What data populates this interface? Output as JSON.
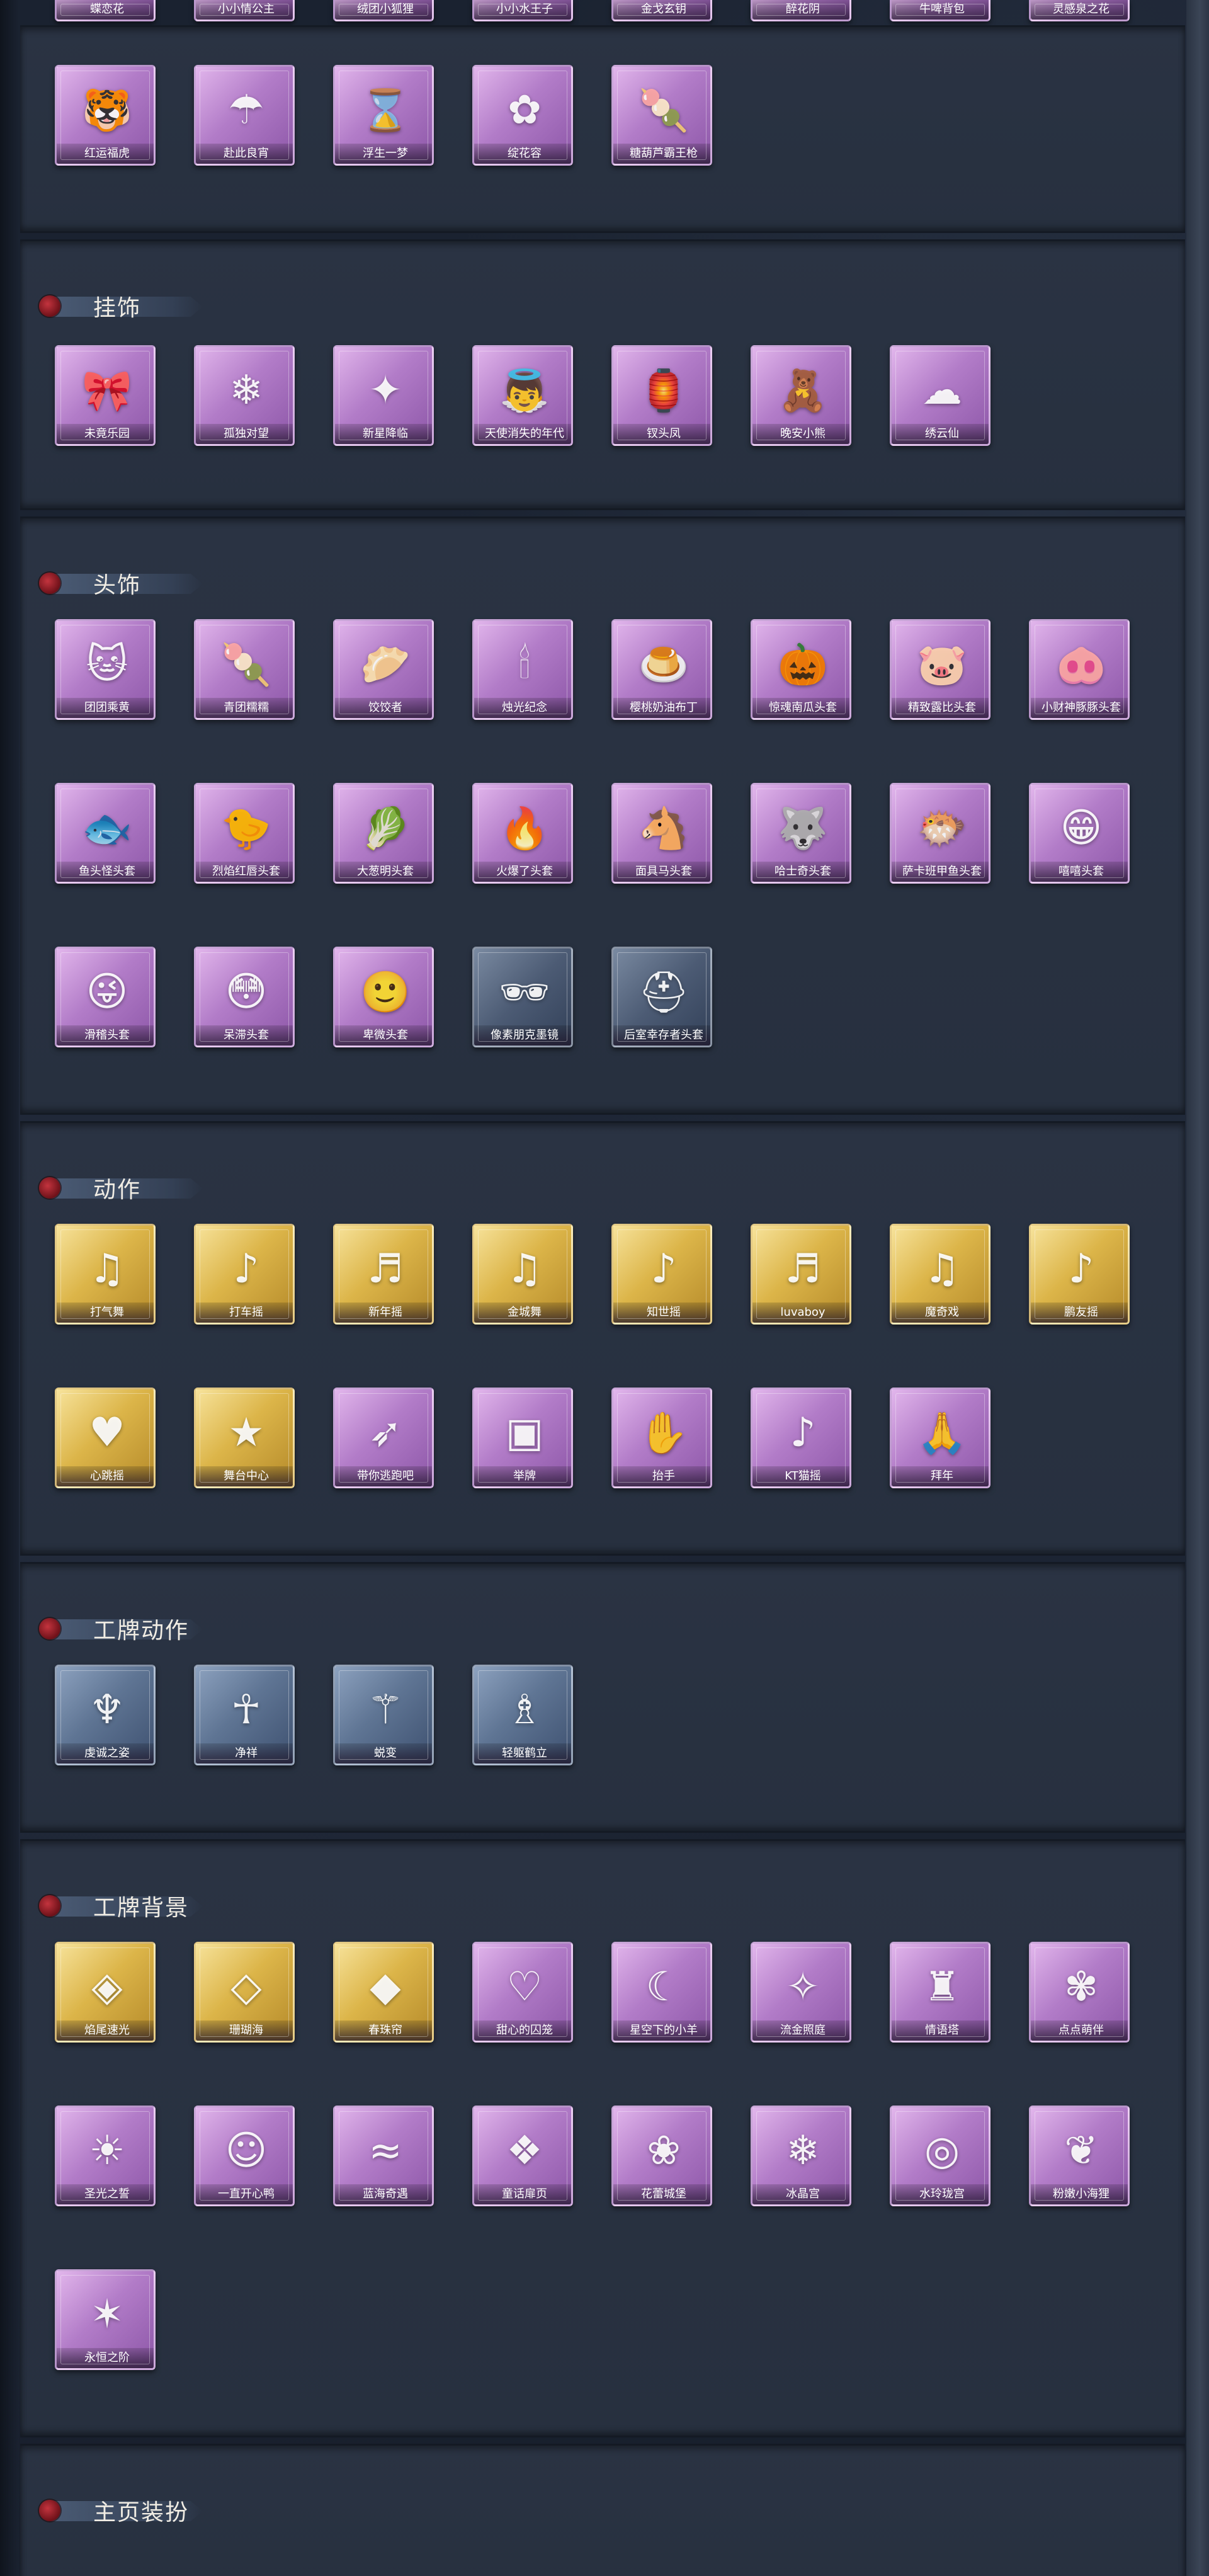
{
  "top_row": [
    "蝶恋花",
    "小小情公主",
    "绒团小狐狸",
    "小小水王子",
    "金戈玄钥",
    "醉花阴",
    "牛啤背包",
    "灵感泉之花"
  ],
  "sections": [
    {
      "title": "",
      "items": [
        {
          "label": "红运福虎",
          "color": "purple",
          "icon": "tiger-icon",
          "glyph": "🐯"
        },
        {
          "label": "赴此良宵",
          "color": "purple",
          "icon": "umbrella-icon",
          "glyph": "☂"
        },
        {
          "label": "浮生一梦",
          "color": "purple",
          "icon": "hourglass-icon",
          "glyph": "⌛"
        },
        {
          "label": "绽花容",
          "color": "purple",
          "icon": "flower-icon",
          "glyph": "✿"
        },
        {
          "label": "糖葫芦霸王枪",
          "color": "purple",
          "icon": "spear-icon",
          "glyph": "🍡"
        }
      ]
    },
    {
      "title": "挂饰",
      "items": [
        {
          "label": "未竟乐园",
          "color": "purple",
          "icon": "doll-icon",
          "glyph": "🎀"
        },
        {
          "label": "孤独对望",
          "color": "purple",
          "icon": "charm-icon",
          "glyph": "❄"
        },
        {
          "label": "新星降临",
          "color": "purple",
          "icon": "star-icon",
          "glyph": "✦"
        },
        {
          "label": "天使消失的年代",
          "color": "purple",
          "icon": "angel-icon",
          "glyph": "👼"
        },
        {
          "label": "钗头凤",
          "color": "purple",
          "icon": "phoenix-icon",
          "glyph": "🏮"
        },
        {
          "label": "晚安小熊",
          "color": "purple",
          "icon": "bear-icon",
          "glyph": "🧸"
        },
        {
          "label": "绣云仙",
          "color": "purple",
          "icon": "cloud-icon",
          "glyph": "☁"
        }
      ]
    },
    {
      "title": "头饰",
      "items": [
        {
          "label": "团团乘黄",
          "color": "purple",
          "icon": "cat-head-icon",
          "glyph": "🐱"
        },
        {
          "label": "青团糯糯",
          "color": "purple",
          "icon": "green-bun-icon",
          "glyph": "🍡"
        },
        {
          "label": "饺饺者",
          "color": "purple",
          "icon": "dumpling-icon",
          "glyph": "🥟"
        },
        {
          "label": "烛光纪念",
          "color": "purple",
          "icon": "candle-icon",
          "glyph": "🕯"
        },
        {
          "label": "樱桃奶油布丁",
          "color": "purple",
          "icon": "pudding-icon",
          "glyph": "🍮"
        },
        {
          "label": "惊魂南瓜头套",
          "color": "purple",
          "icon": "pumpkin-icon",
          "glyph": "🎃"
        },
        {
          "label": "精致露比头套",
          "color": "purple",
          "icon": "pink-mask-icon",
          "glyph": "🐷"
        },
        {
          "label": "小财神豚豚头套",
          "color": "purple",
          "icon": "pig-icon",
          "glyph": "🐽"
        },
        {
          "label": "鱼头怪头套",
          "color": "purple",
          "icon": "fish-head-icon",
          "glyph": "🐟"
        },
        {
          "label": "烈焰红唇头套",
          "color": "purple",
          "icon": "duck-icon",
          "glyph": "🐤"
        },
        {
          "label": "大葱明头套",
          "color": "purple",
          "icon": "scallion-icon",
          "glyph": "🥬"
        },
        {
          "label": "火爆了头套",
          "color": "purple",
          "icon": "fire-icon",
          "glyph": "🔥"
        },
        {
          "label": "面具马头套",
          "color": "purple",
          "icon": "horse-icon",
          "glyph": "🐴"
        },
        {
          "label": "哈士奇头套",
          "color": "purple",
          "icon": "husky-icon",
          "glyph": "🐺"
        },
        {
          "label": "萨卡班甲鱼头套",
          "color": "purple",
          "icon": "fish-icon",
          "glyph": "🐡"
        },
        {
          "label": "嘻嘻头套",
          "color": "purple",
          "icon": "grin-face-icon",
          "glyph": "😁"
        },
        {
          "label": "滑稽头套",
          "color": "purple",
          "icon": "funny-face-icon",
          "glyph": "😜"
        },
        {
          "label": "呆滞头套",
          "color": "purple",
          "icon": "dazed-face-icon",
          "glyph": "😳"
        },
        {
          "label": "卑微头套",
          "color": "purple",
          "icon": "humble-face-icon",
          "glyph": "🙂"
        },
        {
          "label": "像素朋克墨镜",
          "color": "bluegrey",
          "icon": "sunglasses-icon",
          "glyph": "🕶"
        },
        {
          "label": "后室幸存者头套",
          "color": "bluegrey",
          "icon": "gas-mask-icon",
          "glyph": "⛑"
        }
      ]
    },
    {
      "title": "动作",
      "items": [
        {
          "label": "打气舞",
          "color": "gold",
          "icon": "dance-icon",
          "glyph": "♫"
        },
        {
          "label": "打车摇",
          "color": "gold",
          "icon": "dance-icon",
          "glyph": "♪"
        },
        {
          "label": "新年摇",
          "color": "gold",
          "icon": "dance-icon",
          "glyph": "♬"
        },
        {
          "label": "金城舞",
          "color": "gold",
          "icon": "dance-icon",
          "glyph": "♫"
        },
        {
          "label": "知世摇",
          "color": "gold",
          "icon": "dance-icon",
          "glyph": "♪"
        },
        {
          "label": "luvaboy",
          "color": "gold",
          "icon": "dance-icon",
          "glyph": "♬"
        },
        {
          "label": "魔奇戏",
          "color": "gold",
          "icon": "dance-icon",
          "glyph": "♫"
        },
        {
          "label": "鹏友摇",
          "color": "gold",
          "icon": "dance-icon",
          "glyph": "♪"
        },
        {
          "label": "心跳摇",
          "color": "gold",
          "icon": "dance-icon",
          "glyph": "♥"
        },
        {
          "label": "舞台中心",
          "color": "gold",
          "icon": "dance-icon",
          "glyph": "★"
        },
        {
          "label": "带你逃跑吧",
          "color": "purple",
          "icon": "run-icon",
          "glyph": "➶"
        },
        {
          "label": "举牌",
          "color": "purple",
          "icon": "sign-icon",
          "glyph": "▣"
        },
        {
          "label": "抬手",
          "color": "purple",
          "icon": "hand-icon",
          "glyph": "✋"
        },
        {
          "label": "KT猫摇",
          "color": "purple",
          "icon": "dance-icon",
          "glyph": "♪"
        },
        {
          "label": "拜年",
          "color": "purple",
          "icon": "bow-icon",
          "glyph": "🙏"
        }
      ]
    },
    {
      "title": "工牌动作",
      "items": [
        {
          "label": "虔诚之姿",
          "color": "blue",
          "icon": "pose-icon",
          "glyph": "♆"
        },
        {
          "label": "净祥",
          "color": "blue",
          "icon": "pose-icon",
          "glyph": "☥"
        },
        {
          "label": "蜕变",
          "color": "blue",
          "icon": "pose-icon",
          "glyph": "⚚"
        },
        {
          "label": "轻躯鹤立",
          "color": "blue",
          "icon": "pose-icon",
          "glyph": "♗"
        }
      ]
    },
    {
      "title": "工牌背景",
      "items": [
        {
          "label": "焰尾速光",
          "color": "gold",
          "icon": "card-bg-icon",
          "glyph": "◈"
        },
        {
          "label": "珊瑚海",
          "color": "gold",
          "icon": "card-bg-icon",
          "glyph": "◇"
        },
        {
          "label": "春珠帘",
          "color": "gold",
          "icon": "card-bg-icon",
          "glyph": "◆"
        },
        {
          "label": "甜心的囚笼",
          "color": "purple",
          "icon": "card-bg-icon",
          "glyph": "♡"
        },
        {
          "label": "星空下的小羊",
          "color": "purple",
          "icon": "card-bg-icon",
          "glyph": "☾"
        },
        {
          "label": "流金照庭",
          "color": "purple",
          "icon": "card-bg-icon",
          "glyph": "✧"
        },
        {
          "label": "情语塔",
          "color": "purple",
          "icon": "card-bg-icon",
          "glyph": "♜"
        },
        {
          "label": "点点萌伴",
          "color": "purple",
          "icon": "card-bg-icon",
          "glyph": "✾"
        },
        {
          "label": "圣光之誓",
          "color": "purple",
          "icon": "card-bg-icon",
          "glyph": "☀"
        },
        {
          "label": "一直开心鸭",
          "color": "purple",
          "icon": "card-bg-icon",
          "glyph": "☺"
        },
        {
          "label": "蓝海奇遇",
          "color": "purple",
          "icon": "card-bg-icon",
          "glyph": "≈"
        },
        {
          "label": "童话扉页",
          "color": "purple",
          "icon": "card-bg-icon",
          "glyph": "❖"
        },
        {
          "label": "花蕾城堡",
          "color": "purple",
          "icon": "card-bg-icon",
          "glyph": "❀"
        },
        {
          "label": "冰晶宫",
          "color": "purple",
          "icon": "card-bg-icon",
          "glyph": "❄"
        },
        {
          "label": "水玲珑宫",
          "color": "purple",
          "icon": "card-bg-icon",
          "glyph": "◎"
        },
        {
          "label": "粉嫩小海狸",
          "color": "purple",
          "icon": "card-bg-icon",
          "glyph": "❦"
        },
        {
          "label": "永恒之阶",
          "color": "purple",
          "icon": "card-bg-icon",
          "glyph": "✶"
        }
      ]
    },
    {
      "title": "主页装扮",
      "items": []
    }
  ]
}
